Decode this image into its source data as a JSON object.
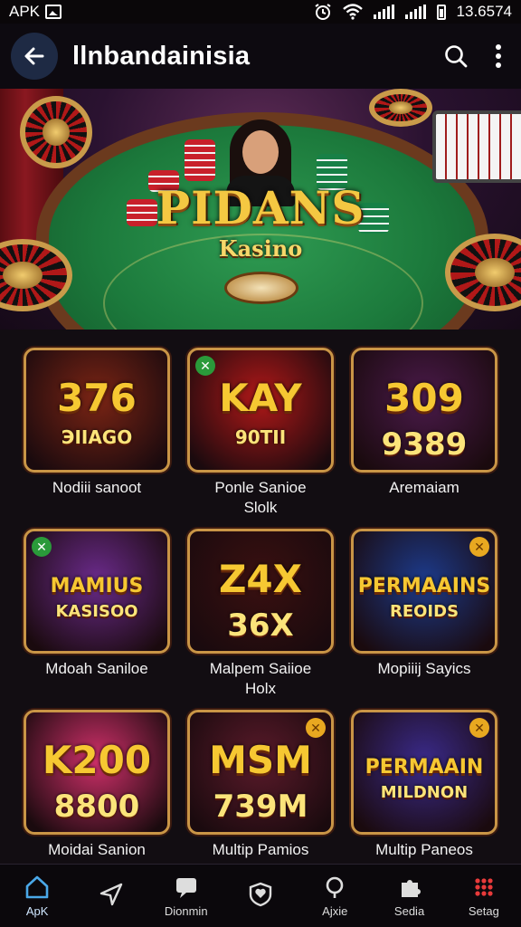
{
  "status_bar": {
    "app_label": "APK",
    "time": "13.6574"
  },
  "app_bar": {
    "title": "llnbandainisia"
  },
  "hero": {
    "title": "PIDANS",
    "subtitle": "Kasino"
  },
  "games": [
    {
      "thumb_text_1": "376",
      "thumb_text_2": "ЭIIAGO",
      "label": "Nodiii sanoot",
      "theme": "#7a2414"
    },
    {
      "thumb_text_1": "KAY",
      "thumb_text_2": "90TII",
      "label": "Ponle Sanioe\nSlolk",
      "theme": "#b01818"
    },
    {
      "thumb_text_1": "309",
      "thumb_text_2": "9389",
      "label": "Aremaiam",
      "theme": "#4a1a4a"
    },
    {
      "thumb_text_1": "MAMIUS",
      "thumb_text_2": "KASISOO",
      "label": "Mdoah Saniloe",
      "theme": "#6a2a8a"
    },
    {
      "thumb_text_1": "Z4X",
      "thumb_text_2": "36X",
      "label": "Malpem Saiioe\nHolx",
      "theme": "#3a1010"
    },
    {
      "thumb_text_1": "PERMAAINS",
      "thumb_text_2": "REOIDS",
      "label": "Mopiiij Sayics",
      "theme": "#1c3a8a"
    },
    {
      "thumb_text_1": "K200",
      "thumb_text_2": "8800",
      "label": "Moidai Sanion",
      "theme": "#d0306a"
    },
    {
      "thumb_text_1": "MSM",
      "thumb_text_2": "739M",
      "label": "Multip Pamios",
      "theme": "#5a1a2a"
    },
    {
      "thumb_text_1": "PERMAAIN",
      "thumb_text_2": "MILDNON",
      "label": "Multip Paneos",
      "theme": "#3a2a8a"
    }
  ],
  "bottom_nav": [
    {
      "label": "ApK",
      "icon": "home-icon"
    },
    {
      "label": "",
      "icon": "send-icon"
    },
    {
      "label": "Dionmin",
      "icon": "message-icon"
    },
    {
      "label": "",
      "icon": "shield-heart-icon"
    },
    {
      "label": "Ajxie",
      "icon": "search-icon"
    },
    {
      "label": "Sedia",
      "icon": "puzzle-icon"
    },
    {
      "label": "Setag",
      "icon": "grid-dots-icon"
    }
  ],
  "colors": {
    "background": "#120d12",
    "gold": "#c99546",
    "nav_active": "#4aa8e8"
  }
}
